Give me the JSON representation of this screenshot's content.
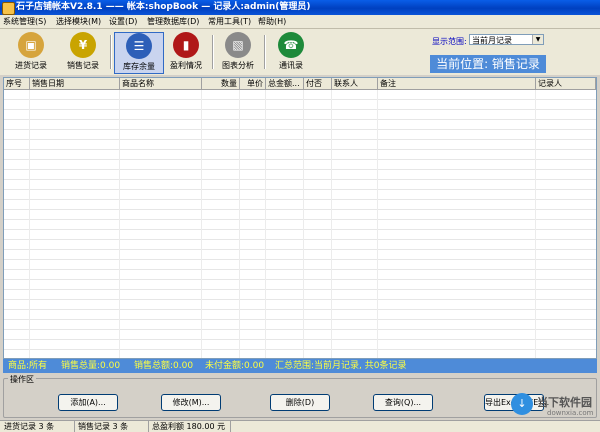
{
  "window": {
    "title": "石子店铺帐本V2.8.1  ——  帐本:shopBook —  记录人:admin(管理员)"
  },
  "menu": [
    "系统管理(S)",
    "选择模块(M)",
    "设置(D)",
    "管理数据库(D)",
    "常用工具(T)",
    "帮助(H)"
  ],
  "toolbar": {
    "buttons": [
      {
        "label": "进货记录",
        "icon": "box-icon",
        "color": "#d6a43c"
      },
      {
        "label": "销售记录",
        "icon": "money-bag-icon",
        "color": "#c9a400"
      },
      {
        "label": "库存余量",
        "icon": "stack-icon",
        "color": "#2d5fb8"
      },
      {
        "label": "盈利情况",
        "icon": "books-icon",
        "color": "#b01818"
      },
      {
        "label": "图表分析",
        "icon": "chart-icon",
        "color": "#8a8a8a"
      },
      {
        "label": "通讯录",
        "icon": "phone-icon",
        "color": "#1e8a3a"
      }
    ],
    "range_label": "显示范围:",
    "range_value": "当前月记录",
    "location": "当前位置: 销售记录"
  },
  "table": {
    "columns": [
      "序号",
      "销售日期",
      "商品名称",
      "数量",
      "单价",
      "总金额...",
      "付否",
      "联系人",
      "备注",
      "记录人"
    ]
  },
  "summary": {
    "goods": "商品:所有",
    "qty": "销售总量:0.00",
    "amount": "销售总额:0.00",
    "unpaid": "未付金额:0.00",
    "scope": "汇总范围:当前月记录, 共0条记录"
  },
  "ops": {
    "group_label": "操作区",
    "add": "添加(A)...",
    "edit": "修改(M)...",
    "delete": "删除(D)",
    "query": "查询(Q)...",
    "export": "导出Excel表(E)..."
  },
  "status": {
    "purchase": "进货记录 3 条",
    "sales": "销售记录 3 条",
    "profit": "总盈利额 180.00 元"
  },
  "watermark": {
    "title": "当下软件园",
    "url": "downxia.com"
  }
}
